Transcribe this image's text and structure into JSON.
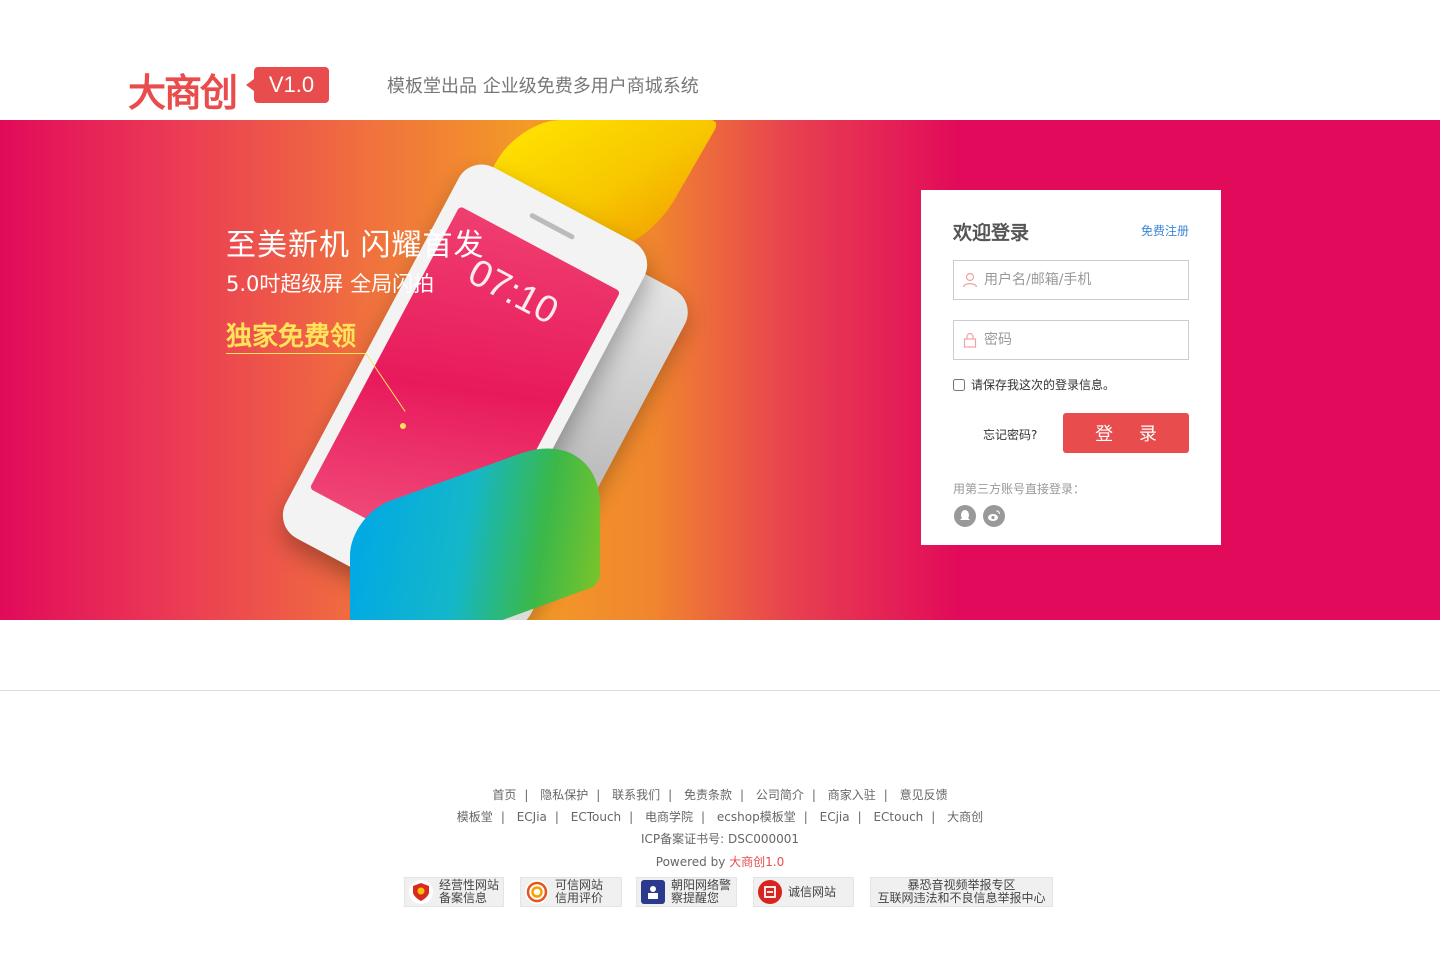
{
  "header": {
    "logo_text": "大商创",
    "version": "V1.0",
    "slogan": "模板堂出品  企业级免费多用户商城系统"
  },
  "banner": {
    "title": "至美新机 闪耀首发",
    "subtitle": "5.0吋超级屏 全局闪拍",
    "promo": "独家免费领",
    "phone_time": "07:10"
  },
  "login": {
    "title": "欢迎登录",
    "register_link": "免费注册",
    "username_placeholder": "用户名/邮箱/手机",
    "password_placeholder": "密码",
    "remember_label": "请保存我这次的登录信息。",
    "forgot_link": "忘记密码?",
    "login_button": "登 录",
    "third_party_label": "用第三方账号直接登录："
  },
  "footer": {
    "row1": [
      "首页",
      "隐私保护",
      "联系我们",
      "免责条款",
      "公司简介",
      "商家入驻",
      "意见反馈"
    ],
    "row2": [
      "模板堂",
      "ECJia",
      "ECTouch",
      "电商学院",
      "ecshop模板堂",
      "ECjia",
      "ECtouch",
      "大商创"
    ],
    "icp": "ICP备案证书号: DSC000001",
    "powered_prefix": "Powered by ",
    "powered_link": "大商创1.0",
    "badges": [
      {
        "line1": "经营性网站",
        "line2": "备案信息"
      },
      {
        "line1": "可信网站",
        "line2": "信用评价"
      },
      {
        "line1": "朝阳网络警",
        "line2": "察提醒您"
      },
      {
        "line1": "诚信网站",
        "line2": ""
      },
      {
        "line1": "暴恐音视频举报专区",
        "line2": "互联网违法和不良信息举报中心"
      }
    ]
  },
  "colors": {
    "brand_red": "#e84c4c",
    "banner_bg": "#e20a5a",
    "link_blue": "#3c86d6"
  }
}
